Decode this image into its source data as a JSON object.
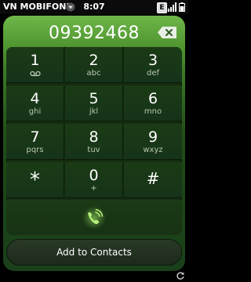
{
  "status_bar": {
    "carrier": "VN MOBIFONE",
    "time": "8:07",
    "battery_badge": "E",
    "icons": [
      "carrier-menu-icon",
      "signal-icon",
      "battery-icon"
    ]
  },
  "dialer": {
    "number": "09392468",
    "icons": [
      "backspace-icon",
      "voicemail-icon",
      "call-icon",
      "rotate-icon"
    ],
    "keys": [
      {
        "digit": "1",
        "letters": ""
      },
      {
        "digit": "2",
        "letters": "abc"
      },
      {
        "digit": "3",
        "letters": "def"
      },
      {
        "digit": "4",
        "letters": "ghi"
      },
      {
        "digit": "5",
        "letters": "jkl"
      },
      {
        "digit": "6",
        "letters": "mno"
      },
      {
        "digit": "7",
        "letters": "pqrs"
      },
      {
        "digit": "8",
        "letters": "tuv"
      },
      {
        "digit": "9",
        "letters": "wxyz"
      },
      {
        "digit": "*",
        "letters": ""
      },
      {
        "digit": "0",
        "letters": "+"
      },
      {
        "digit": "#",
        "letters": ""
      }
    ],
    "add_to_contacts": "Add to Contacts"
  },
  "colors": {
    "accent_green": "#5aa83a",
    "call_glow": "#a8f06a"
  }
}
